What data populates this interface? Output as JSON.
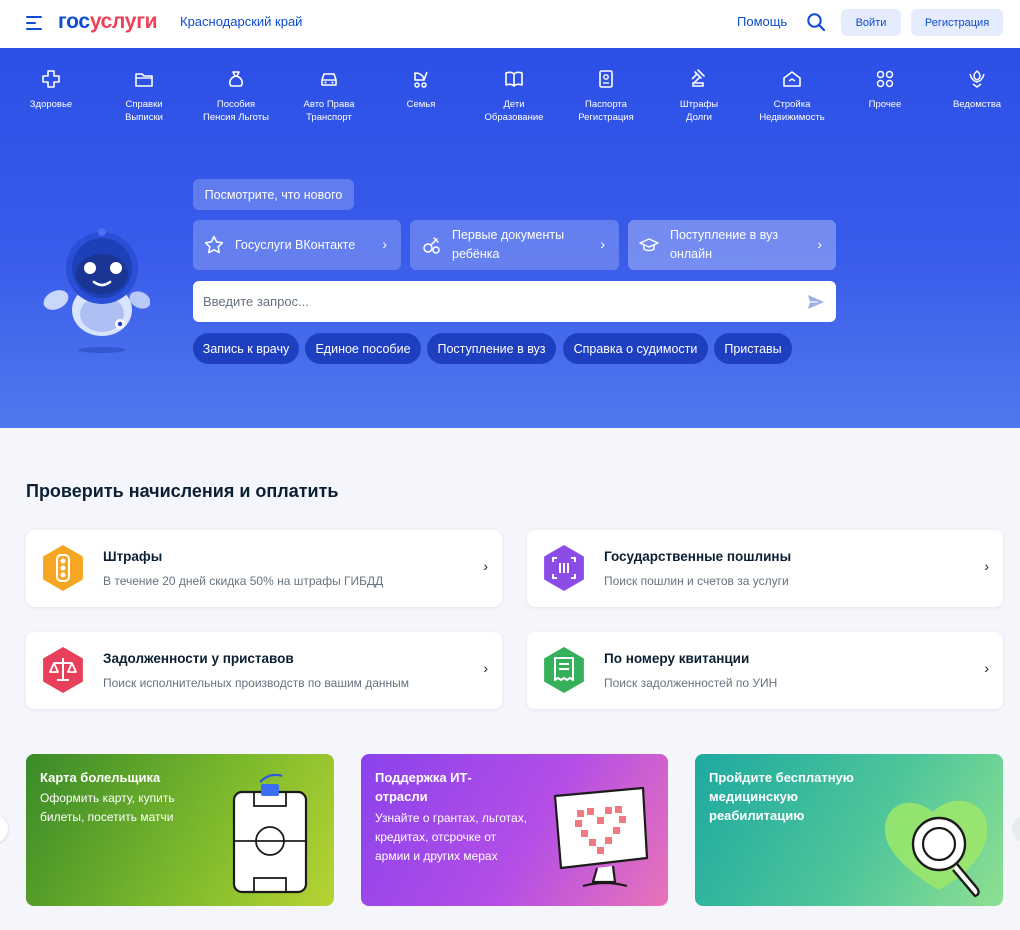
{
  "header": {
    "logo_part1": "гос",
    "logo_part2": "услуги",
    "region": "Краснодарский край",
    "help": "Помощь",
    "login": "Войти",
    "register": "Регистрация"
  },
  "categories": [
    {
      "line1": "Здоровье",
      "line2": "",
      "icon": "health-cross-icon"
    },
    {
      "line1": "Справки",
      "line2": "Выписки",
      "icon": "folder-icon"
    },
    {
      "line1": "Пособия",
      "line2": "Пенсия Льготы",
      "icon": "money-bag-icon"
    },
    {
      "line1": "Авто Права",
      "line2": "Транспорт",
      "icon": "car-icon"
    },
    {
      "line1": "Семья",
      "line2": "",
      "icon": "stroller-icon"
    },
    {
      "line1": "Дети",
      "line2": "Образование",
      "icon": "book-icon"
    },
    {
      "line1": "Паспорта",
      "line2": "Регистрация",
      "icon": "passport-icon"
    },
    {
      "line1": "Штрафы",
      "line2": "Долги",
      "icon": "gavel-icon"
    },
    {
      "line1": "Стройка",
      "line2": "Недвижимость",
      "icon": "house-icon"
    },
    {
      "line1": "Прочее",
      "line2": "",
      "icon": "grid-icon"
    },
    {
      "line1": "Ведомства",
      "line2": "",
      "icon": "emblem-icon"
    }
  ],
  "hero": {
    "news_button": "Посмотрите, что нового",
    "promos": [
      {
        "text": "Госуслуги ВКонтакте",
        "icon": "star-icon"
      },
      {
        "text": "Первые документы ребёнка",
        "icon": "pacifier-icon"
      },
      {
        "text": "Поступление в вуз онлайн",
        "icon": "graduation-cap-icon"
      }
    ],
    "search_placeholder": "Введите запрос...",
    "chips": [
      "Запись к врачу",
      "Единое пособие",
      "Поступление в вуз",
      "Справка о судимости",
      "Приставы"
    ]
  },
  "payments": {
    "title": "Проверить начисления и оплатить",
    "cards": [
      {
        "title": "Штрафы",
        "subtitle": "В течение 20 дней скидка 50% на штрафы ГИБДД",
        "color": "#f5a623",
        "icon": "traffic-light-icon"
      },
      {
        "title": "Государственные пошлины",
        "subtitle": "Поиск пошлин и счетов за услуги",
        "color": "#8b4de6",
        "icon": "barcode-scan-icon"
      },
      {
        "title": "Задолженности у приставов",
        "subtitle": "Поиск исполнительных производств по вашим данным",
        "color": "#e8405a",
        "icon": "scales-icon"
      },
      {
        "title": "По номеру квитанции",
        "subtitle": "Поиск задолженностей по УИН",
        "color": "#36b05a",
        "icon": "receipt-icon"
      }
    ]
  },
  "banners": [
    {
      "title": "Карта болельщика",
      "sub1": "Оформить карту, купить",
      "sub2": "билеты, посетить матчи",
      "sub3": ""
    },
    {
      "title1": "Поддержка ИТ-",
      "title2": "отрасли",
      "sub1": "Узнайте о грантах, льготах,",
      "sub2": "кредитах, отсрочке от",
      "sub3": "армии и других мерах"
    },
    {
      "title1": "Пройдите бесплатную",
      "title2": "медицинскую",
      "title3": "реабилитацию"
    }
  ],
  "colors": {
    "brand_blue": "#0d4cd3",
    "brand_red": "#ee3f58",
    "hero_blue": "#3a5ceb"
  }
}
